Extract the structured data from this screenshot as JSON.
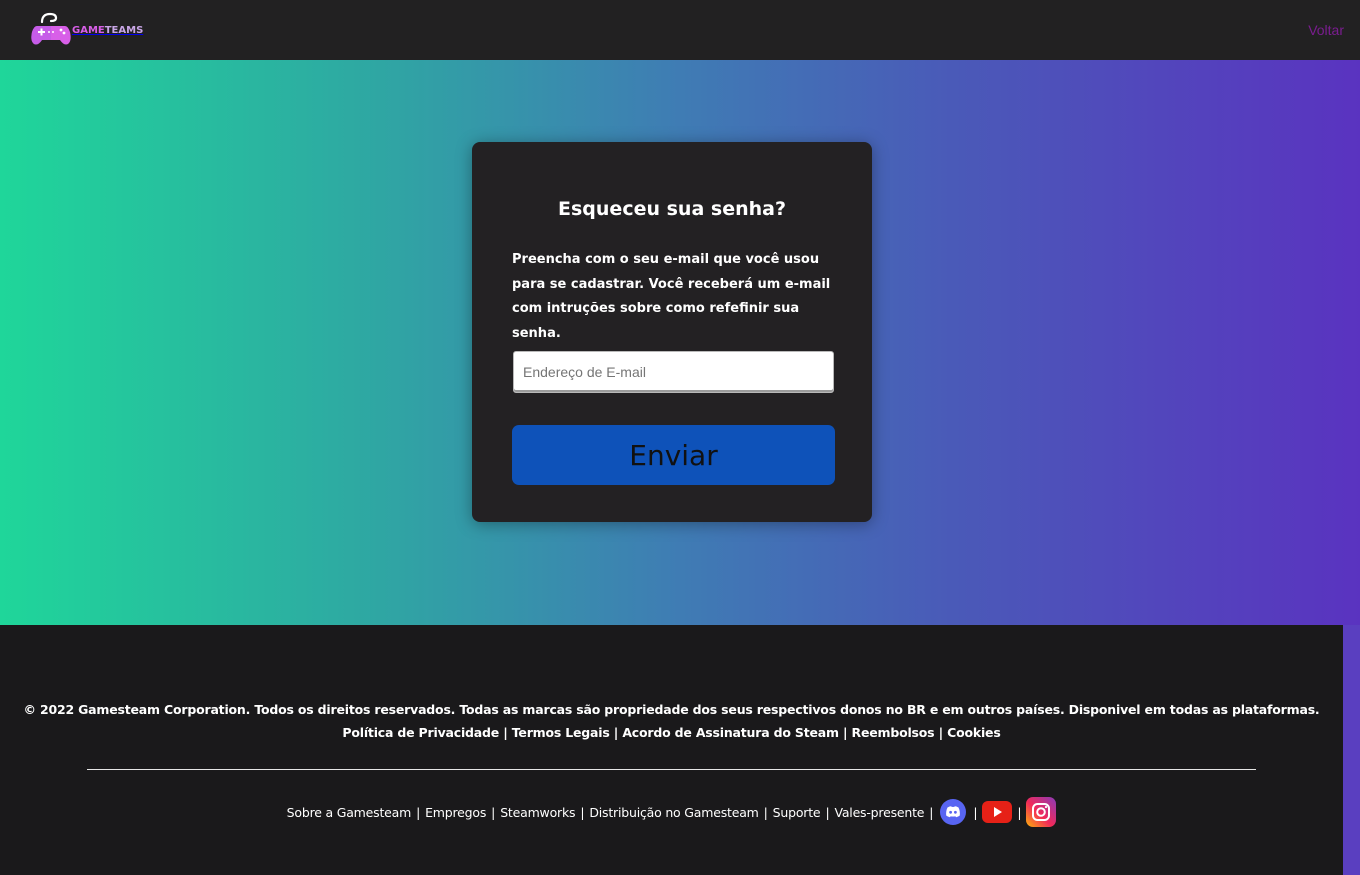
{
  "header": {
    "logo_text_part1": "GAME",
    "logo_text_part2": "TEAMS",
    "back_label": "Voltar"
  },
  "card": {
    "title": "Esqueceu sua senha?",
    "description": "Preencha com o seu e-mail que você usou para se cadastrar. Você receberá um e-mail com intruções sobre como refefinir sua senha.",
    "email_placeholder": "Endereço de E-mail",
    "email_value": "",
    "submit_label": "Enviar"
  },
  "footer": {
    "copyright": "© 2022 Gamesteam Corporation. Todos os direitos reservados. Todas as marcas são propriedade dos seus respectivos donos no BR e em outros países. Disponivel em todas as plataformas.",
    "legal_links": [
      "Política de Privacidade",
      "Termos Legais",
      "Acordo de Assinatura do Steam",
      "Reembolsos",
      "Cookies"
    ],
    "bottom_links": [
      "Sobre a Gamesteam",
      "Empregos",
      "Steamworks",
      "Distribuição no Gamesteam",
      "Suporte",
      "Vales-presente"
    ],
    "separator": "|",
    "social": [
      {
        "name": "discord-icon",
        "color": "#5865f2"
      },
      {
        "name": "youtube-icon",
        "color": "#e62117"
      },
      {
        "name": "instagram-icon",
        "color": "#d6249f"
      }
    ]
  },
  "colors": {
    "hero_gradient_start": "#1fd69a",
    "hero_gradient_end": "#5a33c0",
    "card_bg": "#232123",
    "button_bg": "#0e52b9",
    "back_link": "#7a1d8f"
  }
}
